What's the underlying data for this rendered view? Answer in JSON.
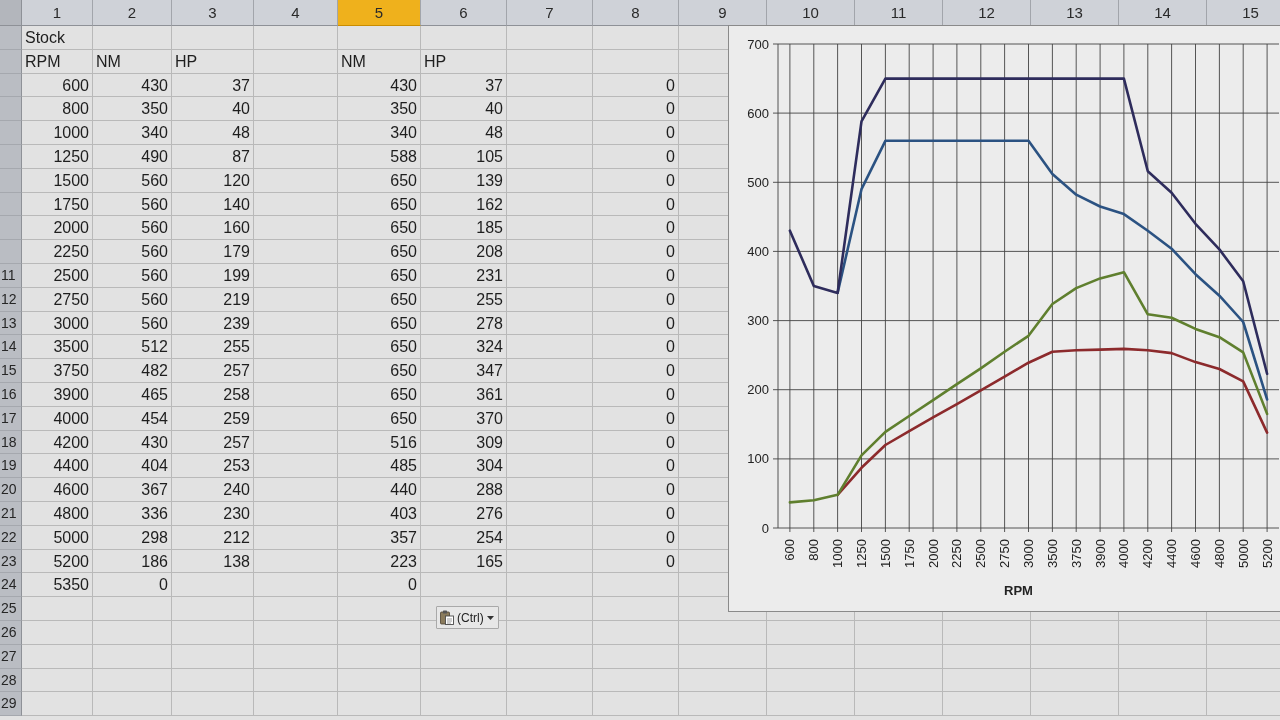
{
  "columns": [
    {
      "label": "1",
      "selected": false
    },
    {
      "label": "2",
      "selected": false
    },
    {
      "label": "3",
      "selected": false
    },
    {
      "label": "4",
      "selected": false
    },
    {
      "label": "5",
      "selected": true
    },
    {
      "label": "6",
      "selected": false
    },
    {
      "label": "7",
      "selected": false
    },
    {
      "label": "8",
      "selected": false
    },
    {
      "label": "9",
      "selected": false
    },
    {
      "label": "10",
      "selected": false
    },
    {
      "label": "11",
      "selected": false
    },
    {
      "label": "12",
      "selected": false
    },
    {
      "label": "13",
      "selected": false
    },
    {
      "label": "14",
      "selected": false
    },
    {
      "label": "15",
      "selected": false
    }
  ],
  "rows": [
    {
      "kind": "label",
      "column_1": "Stock"
    },
    {
      "kind": "label",
      "column_1": "RPM",
      "column_2": "NM",
      "column_3": "HP",
      "column_5": "NM",
      "column_6": "HP"
    },
    {
      "kind": "data",
      "column_1": "600",
      "column_2": "430",
      "column_3": "37",
      "column_5": "430",
      "column_6": "37",
      "column_8": "0"
    },
    {
      "kind": "data",
      "column_1": "800",
      "column_2": "350",
      "column_3": "40",
      "column_5": "350",
      "column_6": "40",
      "column_8": "0"
    },
    {
      "kind": "data",
      "column_1": "1000",
      "column_2": "340",
      "column_3": "48",
      "column_5": "340",
      "column_6": "48",
      "column_8": "0"
    },
    {
      "kind": "data",
      "column_1": "1250",
      "column_2": "490",
      "column_3": "87",
      "column_5": "588",
      "column_6": "105",
      "column_8": "0"
    },
    {
      "kind": "data",
      "column_1": "1500",
      "column_2": "560",
      "column_3": "120",
      "column_5": "650",
      "column_6": "139",
      "column_8": "0"
    },
    {
      "kind": "data",
      "column_1": "1750",
      "column_2": "560",
      "column_3": "140",
      "column_5": "650",
      "column_6": "162",
      "column_8": "0"
    },
    {
      "kind": "data",
      "column_1": "2000",
      "column_2": "560",
      "column_3": "160",
      "column_5": "650",
      "column_6": "185",
      "column_8": "0"
    },
    {
      "kind": "data",
      "column_1": "2250",
      "column_2": "560",
      "column_3": "179",
      "column_5": "650",
      "column_6": "208",
      "column_8": "0"
    },
    {
      "kind": "data",
      "row_header": "11",
      "column_1": "2500",
      "column_2": "560",
      "column_3": "199",
      "column_5": "650",
      "column_6": "231",
      "column_8": "0"
    },
    {
      "kind": "data",
      "row_header": "12",
      "column_1": "2750",
      "column_2": "560",
      "column_3": "219",
      "column_5": "650",
      "column_6": "255",
      "column_8": "0"
    },
    {
      "kind": "data",
      "row_header": "13",
      "column_1": "3000",
      "column_2": "560",
      "column_3": "239",
      "column_5": "650",
      "column_6": "278",
      "column_8": "0"
    },
    {
      "kind": "data",
      "row_header": "14",
      "column_1": "3500",
      "column_2": "512",
      "column_3": "255",
      "column_5": "650",
      "column_6": "324",
      "column_8": "0"
    },
    {
      "kind": "data",
      "row_header": "15",
      "column_1": "3750",
      "column_2": "482",
      "column_3": "257",
      "column_5": "650",
      "column_6": "347",
      "column_8": "0"
    },
    {
      "kind": "data",
      "row_header": "16",
      "column_1": "3900",
      "column_2": "465",
      "column_3": "258",
      "column_5": "650",
      "column_6": "361",
      "column_8": "0"
    },
    {
      "kind": "data",
      "row_header": "17",
      "column_1": "4000",
      "column_2": "454",
      "column_3": "259",
      "column_5": "650",
      "column_6": "370",
      "column_8": "0"
    },
    {
      "kind": "data",
      "row_header": "18",
      "column_1": "4200",
      "column_2": "430",
      "column_3": "257",
      "column_5": "516",
      "column_6": "309",
      "column_8": "0"
    },
    {
      "kind": "data",
      "row_header": "19",
      "column_1": "4400",
      "column_2": "404",
      "column_3": "253",
      "column_5": "485",
      "column_6": "304",
      "column_8": "0"
    },
    {
      "kind": "data",
      "row_header": "20",
      "column_1": "4600",
      "column_2": "367",
      "column_3": "240",
      "column_5": "440",
      "column_6": "288",
      "column_8": "0"
    },
    {
      "kind": "data",
      "row_header": "21",
      "column_1": "4800",
      "column_2": "336",
      "column_3": "230",
      "column_5": "403",
      "column_6": "276",
      "column_8": "0"
    },
    {
      "kind": "data",
      "row_header": "22",
      "column_1": "5000",
      "column_2": "298",
      "column_3": "212",
      "column_5": "357",
      "column_6": "254",
      "column_8": "0"
    },
    {
      "kind": "data",
      "row_header": "23",
      "column_1": "5200",
      "column_2": "186",
      "column_3": "138",
      "column_5": "223",
      "column_6": "165",
      "column_8": "0"
    },
    {
      "kind": "data",
      "row_header": "24",
      "column_1": "5350",
      "column_2": "0",
      "column_5": "0"
    },
    {
      "row_header": "25"
    },
    {
      "row_header": "26"
    },
    {
      "row_header": "27"
    },
    {
      "row_header": "28"
    },
    {
      "row_header": "29"
    }
  ],
  "chart": {
    "chart_data": {
      "type": "line",
      "xlabel": "RPM",
      "grid": true,
      "categories": [
        "600",
        "800",
        "1000",
        "1250",
        "1500",
        "1750",
        "2000",
        "2250",
        "2500",
        "2750",
        "3000",
        "3500",
        "3750",
        "3900",
        "4000",
        "4200",
        "4400",
        "4600",
        "4800",
        "5000",
        "5200"
      ],
      "ylim": [
        0,
        700
      ],
      "yticks": [
        0,
        100,
        200,
        300,
        400,
        500,
        600,
        700
      ],
      "series": [
        {
          "color": "#2b5282",
          "values": [
            null,
            null,
            340,
            490,
            560,
            560,
            560,
            560,
            560,
            560,
            560,
            512,
            482,
            465,
            454,
            430,
            404,
            367,
            336,
            298,
            186
          ]
        },
        {
          "color": "#8c2a2c",
          "values": [
            null,
            null,
            48,
            87,
            120,
            140,
            160,
            179,
            199,
            219,
            239,
            255,
            257,
            258,
            259,
            257,
            253,
            240,
            230,
            212,
            138
          ]
        },
        {
          "color": "#2e2c5c",
          "values": [
            430,
            350,
            340,
            588,
            650,
            650,
            650,
            650,
            650,
            650,
            650,
            650,
            650,
            650,
            650,
            516,
            485,
            440,
            403,
            357,
            223
          ]
        },
        {
          "color": "#5f7f2e",
          "values": [
            37,
            40,
            48,
            105,
            139,
            162,
            185,
            208,
            231,
            255,
            278,
            324,
            347,
            361,
            370,
            309,
            304,
            288,
            276,
            254,
            165
          ]
        }
      ]
    }
  },
  "paste_options": {
    "label": "(Ctrl)"
  }
}
